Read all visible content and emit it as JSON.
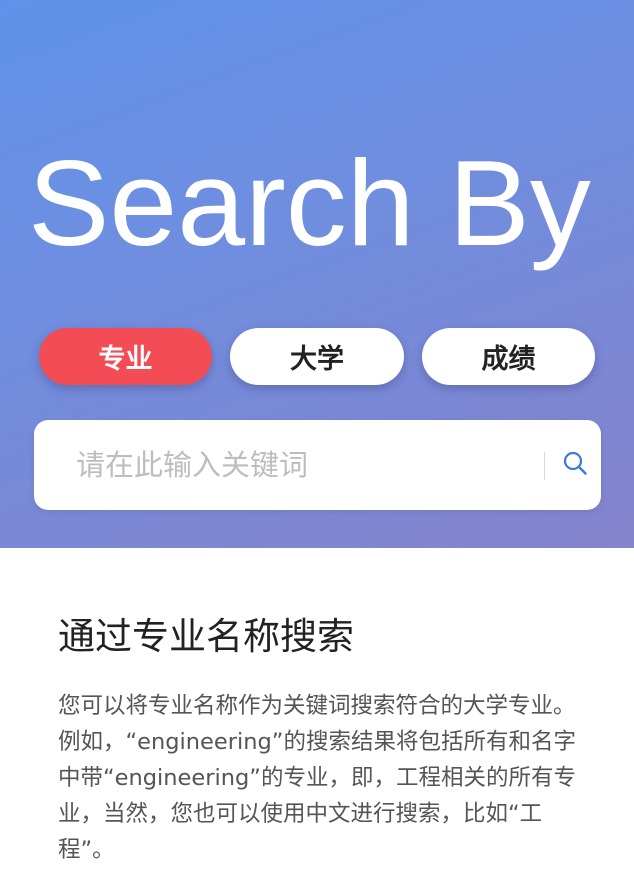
{
  "hero": {
    "title": "Search By"
  },
  "tabs": [
    {
      "label": "专业",
      "active": true
    },
    {
      "label": "大学",
      "active": false
    },
    {
      "label": "成绩",
      "active": false
    }
  ],
  "search": {
    "placeholder": "请在此输入关键词",
    "value": "",
    "icon": "search-icon"
  },
  "section": {
    "title": "通过专业名称搜索",
    "body": "您可以将专业名称作为关键词搜索符合的大学专业。例如，“engineering”的搜索结果将包括所有和名字中带“engineering”的专业，即，工程相关的所有专业，当然，您也可以使用中文进行搜索，比如“工程”。"
  },
  "colors": {
    "hero_gradient_start": "#5f93e9",
    "hero_gradient_end": "#8583cc",
    "active_tab": "#f34c55",
    "search_icon": "#3a7bd5"
  }
}
